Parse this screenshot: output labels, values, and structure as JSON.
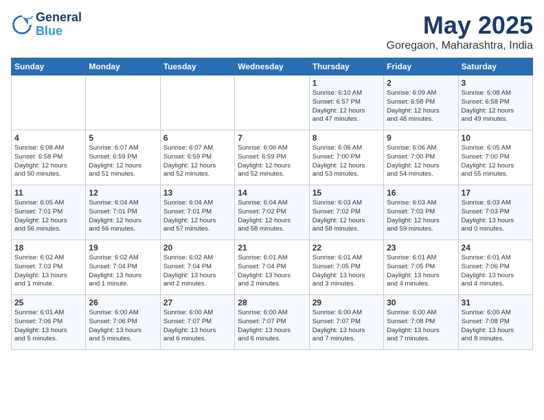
{
  "header": {
    "logo_line1": "General",
    "logo_line2": "Blue",
    "month": "May 2025",
    "location": "Goregaon, Maharashtra, India"
  },
  "weekdays": [
    "Sunday",
    "Monday",
    "Tuesday",
    "Wednesday",
    "Thursday",
    "Friday",
    "Saturday"
  ],
  "rows": [
    [
      {
        "day": "",
        "info": ""
      },
      {
        "day": "",
        "info": ""
      },
      {
        "day": "",
        "info": ""
      },
      {
        "day": "",
        "info": ""
      },
      {
        "day": "1",
        "info": "Sunrise: 6:10 AM\nSunset: 6:57 PM\nDaylight: 12 hours\nand 47 minutes."
      },
      {
        "day": "2",
        "info": "Sunrise: 6:09 AM\nSunset: 6:58 PM\nDaylight: 12 hours\nand 48 minutes."
      },
      {
        "day": "3",
        "info": "Sunrise: 6:08 AM\nSunset: 6:58 PM\nDaylight: 12 hours\nand 49 minutes."
      }
    ],
    [
      {
        "day": "4",
        "info": "Sunrise: 6:08 AM\nSunset: 6:58 PM\nDaylight: 12 hours\nand 50 minutes."
      },
      {
        "day": "5",
        "info": "Sunrise: 6:07 AM\nSunset: 6:59 PM\nDaylight: 12 hours\nand 51 minutes."
      },
      {
        "day": "6",
        "info": "Sunrise: 6:07 AM\nSunset: 6:59 PM\nDaylight: 12 hours\nand 52 minutes."
      },
      {
        "day": "7",
        "info": "Sunrise: 6:06 AM\nSunset: 6:59 PM\nDaylight: 12 hours\nand 52 minutes."
      },
      {
        "day": "8",
        "info": "Sunrise: 6:06 AM\nSunset: 7:00 PM\nDaylight: 12 hours\nand 53 minutes."
      },
      {
        "day": "9",
        "info": "Sunrise: 6:06 AM\nSunset: 7:00 PM\nDaylight: 12 hours\nand 54 minutes."
      },
      {
        "day": "10",
        "info": "Sunrise: 6:05 AM\nSunset: 7:00 PM\nDaylight: 12 hours\nand 55 minutes."
      }
    ],
    [
      {
        "day": "11",
        "info": "Sunrise: 6:05 AM\nSunset: 7:01 PM\nDaylight: 12 hours\nand 56 minutes."
      },
      {
        "day": "12",
        "info": "Sunrise: 6:04 AM\nSunset: 7:01 PM\nDaylight: 12 hours\nand 56 minutes."
      },
      {
        "day": "13",
        "info": "Sunrise: 6:04 AM\nSunset: 7:01 PM\nDaylight: 12 hours\nand 57 minutes."
      },
      {
        "day": "14",
        "info": "Sunrise: 6:04 AM\nSunset: 7:02 PM\nDaylight: 12 hours\nand 58 minutes."
      },
      {
        "day": "15",
        "info": "Sunrise: 6:03 AM\nSunset: 7:02 PM\nDaylight: 12 hours\nand 58 minutes."
      },
      {
        "day": "16",
        "info": "Sunrise: 6:03 AM\nSunset: 7:03 PM\nDaylight: 12 hours\nand 59 minutes."
      },
      {
        "day": "17",
        "info": "Sunrise: 6:03 AM\nSunset: 7:03 PM\nDaylight: 13 hours\nand 0 minutes."
      }
    ],
    [
      {
        "day": "18",
        "info": "Sunrise: 6:02 AM\nSunset: 7:03 PM\nDaylight: 13 hours\nand 1 minute."
      },
      {
        "day": "19",
        "info": "Sunrise: 6:02 AM\nSunset: 7:04 PM\nDaylight: 13 hours\nand 1 minute."
      },
      {
        "day": "20",
        "info": "Sunrise: 6:02 AM\nSunset: 7:04 PM\nDaylight: 13 hours\nand 2 minutes."
      },
      {
        "day": "21",
        "info": "Sunrise: 6:01 AM\nSunset: 7:04 PM\nDaylight: 13 hours\nand 2 minutes."
      },
      {
        "day": "22",
        "info": "Sunrise: 6:01 AM\nSunset: 7:05 PM\nDaylight: 13 hours\nand 3 minutes."
      },
      {
        "day": "23",
        "info": "Sunrise: 6:01 AM\nSunset: 7:05 PM\nDaylight: 13 hours\nand 4 minutes."
      },
      {
        "day": "24",
        "info": "Sunrise: 6:01 AM\nSunset: 7:06 PM\nDaylight: 13 hours\nand 4 minutes."
      }
    ],
    [
      {
        "day": "25",
        "info": "Sunrise: 6:01 AM\nSunset: 7:06 PM\nDaylight: 13 hours\nand 5 minutes."
      },
      {
        "day": "26",
        "info": "Sunrise: 6:00 AM\nSunset: 7:06 PM\nDaylight: 13 hours\nand 5 minutes."
      },
      {
        "day": "27",
        "info": "Sunrise: 6:00 AM\nSunset: 7:07 PM\nDaylight: 13 hours\nand 6 minutes."
      },
      {
        "day": "28",
        "info": "Sunrise: 6:00 AM\nSunset: 7:07 PM\nDaylight: 13 hours\nand 6 minutes."
      },
      {
        "day": "29",
        "info": "Sunrise: 6:00 AM\nSunset: 7:07 PM\nDaylight: 13 hours\nand 7 minutes."
      },
      {
        "day": "30",
        "info": "Sunrise: 6:00 AM\nSunset: 7:08 PM\nDaylight: 13 hours\nand 7 minutes."
      },
      {
        "day": "31",
        "info": "Sunrise: 6:00 AM\nSunset: 7:08 PM\nDaylight: 13 hours\nand 8 minutes."
      }
    ]
  ]
}
